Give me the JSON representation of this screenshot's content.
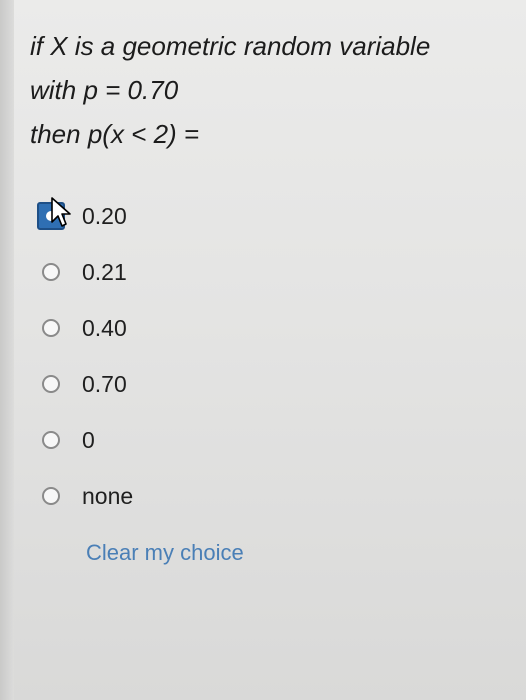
{
  "question": {
    "line1": "if X is a geometric random variable",
    "line2": "with p = 0.70",
    "line3": "then p(x < 2) ="
  },
  "options": [
    {
      "label": "0.20",
      "selected": true
    },
    {
      "label": "0.21",
      "selected": false
    },
    {
      "label": "0.40",
      "selected": false
    },
    {
      "label": "0.70",
      "selected": false
    },
    {
      "label": "0",
      "selected": false
    },
    {
      "label": "none",
      "selected": false
    }
  ],
  "clear_label": "Clear my choice",
  "colors": {
    "accent": "#2f6fb3",
    "link": "#4a7fb6",
    "background": "#e4e4e3"
  }
}
